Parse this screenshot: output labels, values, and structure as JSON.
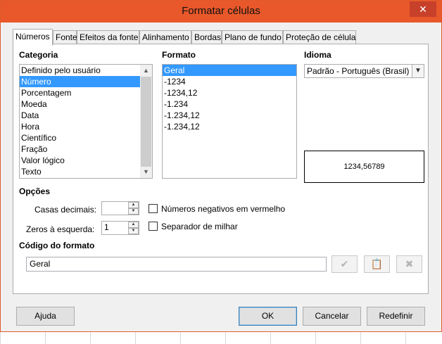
{
  "window": {
    "title": "Formatar células",
    "close_glyph": "✕"
  },
  "tabs": [
    {
      "label": "Números",
      "active": true
    },
    {
      "label": "Fonte"
    },
    {
      "label": "Efeitos da fonte"
    },
    {
      "label": "Alinhamento"
    },
    {
      "label": "Bordas"
    },
    {
      "label": "Plano de fundo"
    },
    {
      "label": "Proteção de célula"
    }
  ],
  "categoria": {
    "label": "Categoria",
    "items": [
      "Definido pelo usuário",
      "Número",
      "Porcentagem",
      "Moeda",
      "Data",
      "Hora",
      "Científico",
      "Fração",
      "Valor lógico",
      "Texto"
    ],
    "selected_index": 1
  },
  "formato": {
    "label": "Formato",
    "items": [
      "Geral",
      "-1234",
      "-1234,12",
      "-1.234",
      "-1.234,12",
      "-1.234,12"
    ],
    "selected_index": 0
  },
  "idioma": {
    "label": "Idioma",
    "value": "Padrão - Português (Brasil)"
  },
  "preview": {
    "text": "1234,56789"
  },
  "opcoes": {
    "label": "Opções",
    "casas_decimais_label": "Casas decimais:",
    "casas_decimais_value": "",
    "zeros_label": "Zeros à esquerda:",
    "zeros_value": "1",
    "negativos_label": "Números negativos em vermelho",
    "negativos_checked": false,
    "separador_label": "Separador de milhar",
    "separador_checked": false
  },
  "codigo": {
    "label": "Código do formato",
    "value": "Geral"
  },
  "buttons": {
    "ajuda": "Ajuda",
    "ok": "OK",
    "cancelar": "Cancelar",
    "redefinir": "Redefinir"
  },
  "colors": {
    "titlebar": "#e9582a",
    "selection": "#3399ff",
    "close": "#c7402a"
  }
}
